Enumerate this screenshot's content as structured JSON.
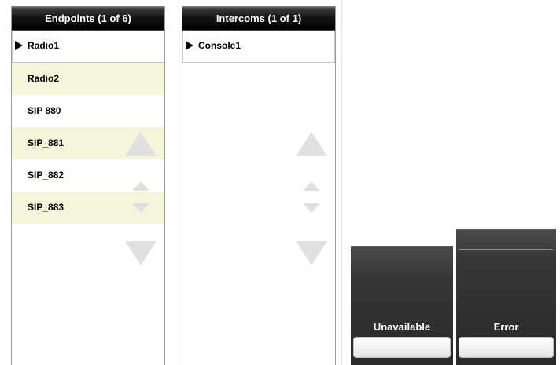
{
  "endpoints_panel": {
    "title": "Endpoints (1 of 6)",
    "items": [
      {
        "label": "Radio1",
        "selected": true
      },
      {
        "label": "Radio2",
        "selected": false
      },
      {
        "label": "SIP 880",
        "selected": false
      },
      {
        "label": "SIP_881",
        "selected": false
      },
      {
        "label": "SIP_882",
        "selected": false
      },
      {
        "label": "SIP_883",
        "selected": false
      }
    ]
  },
  "intercoms_panel": {
    "title": "Intercoms (1 of 1)",
    "items": [
      {
        "label": "Console1",
        "selected": true
      }
    ]
  },
  "status_tiles": [
    {
      "label": "Unavailable"
    },
    {
      "label": "Error"
    }
  ],
  "colors": {
    "header_background": "#000000",
    "alternate_row": "#f5f5dc",
    "arrow_disabled": "#e0e0e0",
    "tile_background": "#363636"
  },
  "icons": {
    "selected_marker": "play-triangle-icon",
    "scroll_page_up": "triangle-up-large-icon",
    "scroll_line_up": "triangle-up-small-icon",
    "scroll_line_down": "triangle-down-small-icon",
    "scroll_page_down": "triangle-down-large-icon"
  }
}
